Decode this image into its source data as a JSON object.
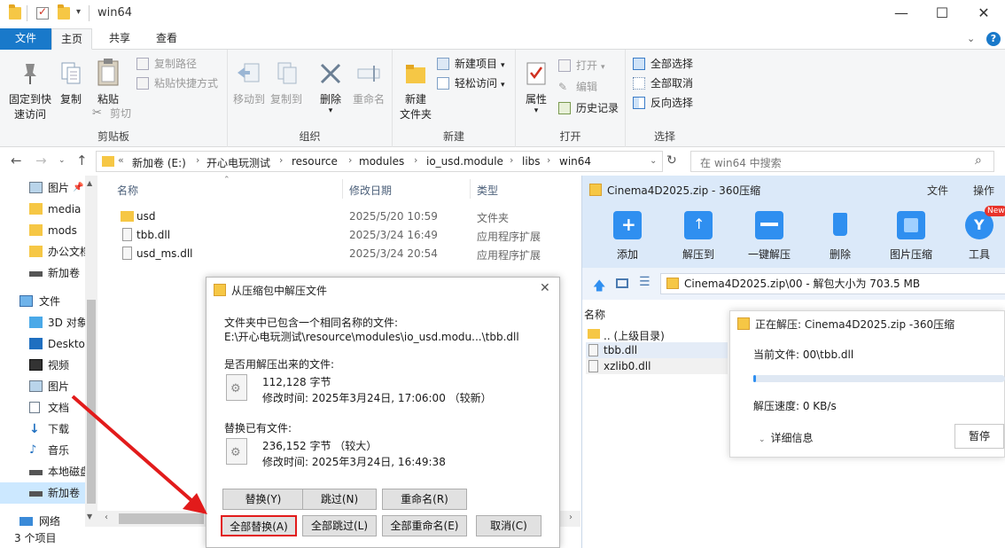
{
  "window": {
    "title": "win64",
    "minimize": "—",
    "maximize": "☐",
    "close": "✕"
  },
  "tabs": [
    {
      "label": "文件"
    },
    {
      "label": "主页"
    },
    {
      "label": "共享"
    },
    {
      "label": "查看"
    }
  ],
  "ribbon": {
    "clipboard": {
      "label": "剪贴板",
      "pin_line1": "固定到快",
      "pin_line2": "速访问",
      "copy": "复制",
      "paste": "粘贴",
      "copy_path": "复制路径",
      "paste_shortcut": "粘贴快捷方式",
      "cut": "剪切"
    },
    "organize": {
      "label": "组织",
      "move_to": "移动到",
      "copy_to": "复制到",
      "delete": "删除",
      "rename": "重命名"
    },
    "new": {
      "label": "新建",
      "new_folder_line1": "新建",
      "new_folder_line2": "文件夹",
      "new_item": "新建项目",
      "easy_access": "轻松访问"
    },
    "open": {
      "label": "打开",
      "properties": "属性",
      "open": "打开",
      "edit": "编辑",
      "history": "历史记录"
    },
    "select": {
      "label": "选择",
      "select_all": "全部选择",
      "select_none": "全部取消",
      "invert": "反向选择"
    }
  },
  "address": {
    "crumbs": [
      "新加卷 (E:)",
      "开心电玩测试",
      "resource",
      "modules",
      "io_usd.module",
      "libs",
      "win64"
    ],
    "search_placeholder": "在 win64 中搜索"
  },
  "navpane": [
    {
      "label": "图片",
      "icon": "pictures-icon"
    },
    {
      "label": "media",
      "icon": "folder-icon"
    },
    {
      "label": "mods",
      "icon": "folder-icon"
    },
    {
      "label": "办公文档",
      "icon": "folder-icon"
    },
    {
      "label": "新加卷",
      "icon": "drive-icon"
    },
    {
      "label": "文件",
      "icon": "computer-icon"
    },
    {
      "label": "3D 对象",
      "icon": "cube-icon"
    },
    {
      "label": "Desktop",
      "icon": "desktop-icon"
    },
    {
      "label": "视频",
      "icon": "video-icon"
    },
    {
      "label": "图片",
      "icon": "pictures-icon"
    },
    {
      "label": "文档",
      "icon": "document-icon"
    },
    {
      "label": "下载",
      "icon": "download-icon"
    },
    {
      "label": "音乐",
      "icon": "music-icon"
    },
    {
      "label": "本地磁盘",
      "icon": "drive-icon"
    },
    {
      "label": "新加卷",
      "icon": "drive-icon"
    },
    {
      "label": "网络",
      "icon": "network-icon"
    }
  ],
  "filelist": {
    "columns": {
      "name": "名称",
      "date": "修改日期",
      "type": "类型"
    },
    "rows": [
      {
        "name": "usd",
        "date": "2025/5/20 10:59",
        "type": "文件夹",
        "icon": "folder-icon"
      },
      {
        "name": "tbb.dll",
        "date": "2025/3/24 16:49",
        "type": "应用程序扩展",
        "icon": "dll-icon"
      },
      {
        "name": "usd_ms.dll",
        "date": "2025/3/24 20:54",
        "type": "应用程序扩展",
        "icon": "dll-icon"
      }
    ],
    "status": "3 个项目"
  },
  "zip": {
    "title": "Cinema4D2025.zip - 360压缩",
    "menu_file": "文件",
    "menu_action": "操作",
    "tools": [
      "添加",
      "解压到",
      "一键解压",
      "删除",
      "图片压缩",
      "工具"
    ],
    "new_badge": "New",
    "path": "Cinema4D2025.zip\\00 - 解包大小为 703.5 MB",
    "col_name": "名称",
    "rows": [
      ".. (上级目录)",
      "tbb.dll",
      "xzlib0.dll"
    ]
  },
  "dialog": {
    "title": "从压缩包中解压文件",
    "msg": "文件夹中已包含一个相同名称的文件:",
    "path": "E:\\开心电玩测试\\resource\\modules\\io_usd.modu...\\tbb.dll",
    "q_new": "是否用解压出来的文件:",
    "new_size": "112,128 字节",
    "new_date": "修改时间: 2025年3月24日, 17:06:00 （较新）",
    "q_old": "替换已有文件:",
    "old_size": "236,152 字节 （较大）",
    "old_date": "修改时间: 2025年3月24日, 16:49:38",
    "btn_replace": "替换(Y)",
    "btn_skip": "跳过(N)",
    "btn_rename": "重命名(R)",
    "btn_replace_all": "全部替换(A)",
    "btn_skip_all": "全部跳过(L)",
    "btn_rename_all": "全部重命名(E)",
    "btn_cancel": "取消(C)",
    "close": "✕"
  },
  "progress": {
    "title": "正在解压: Cinema4D2025.zip -360压缩",
    "current": "当前文件: 00\\tbb.dll",
    "speed": "解压速度: 0 KB/s",
    "details": "详细信息",
    "pause": "暂停",
    "percent": 1
  }
}
